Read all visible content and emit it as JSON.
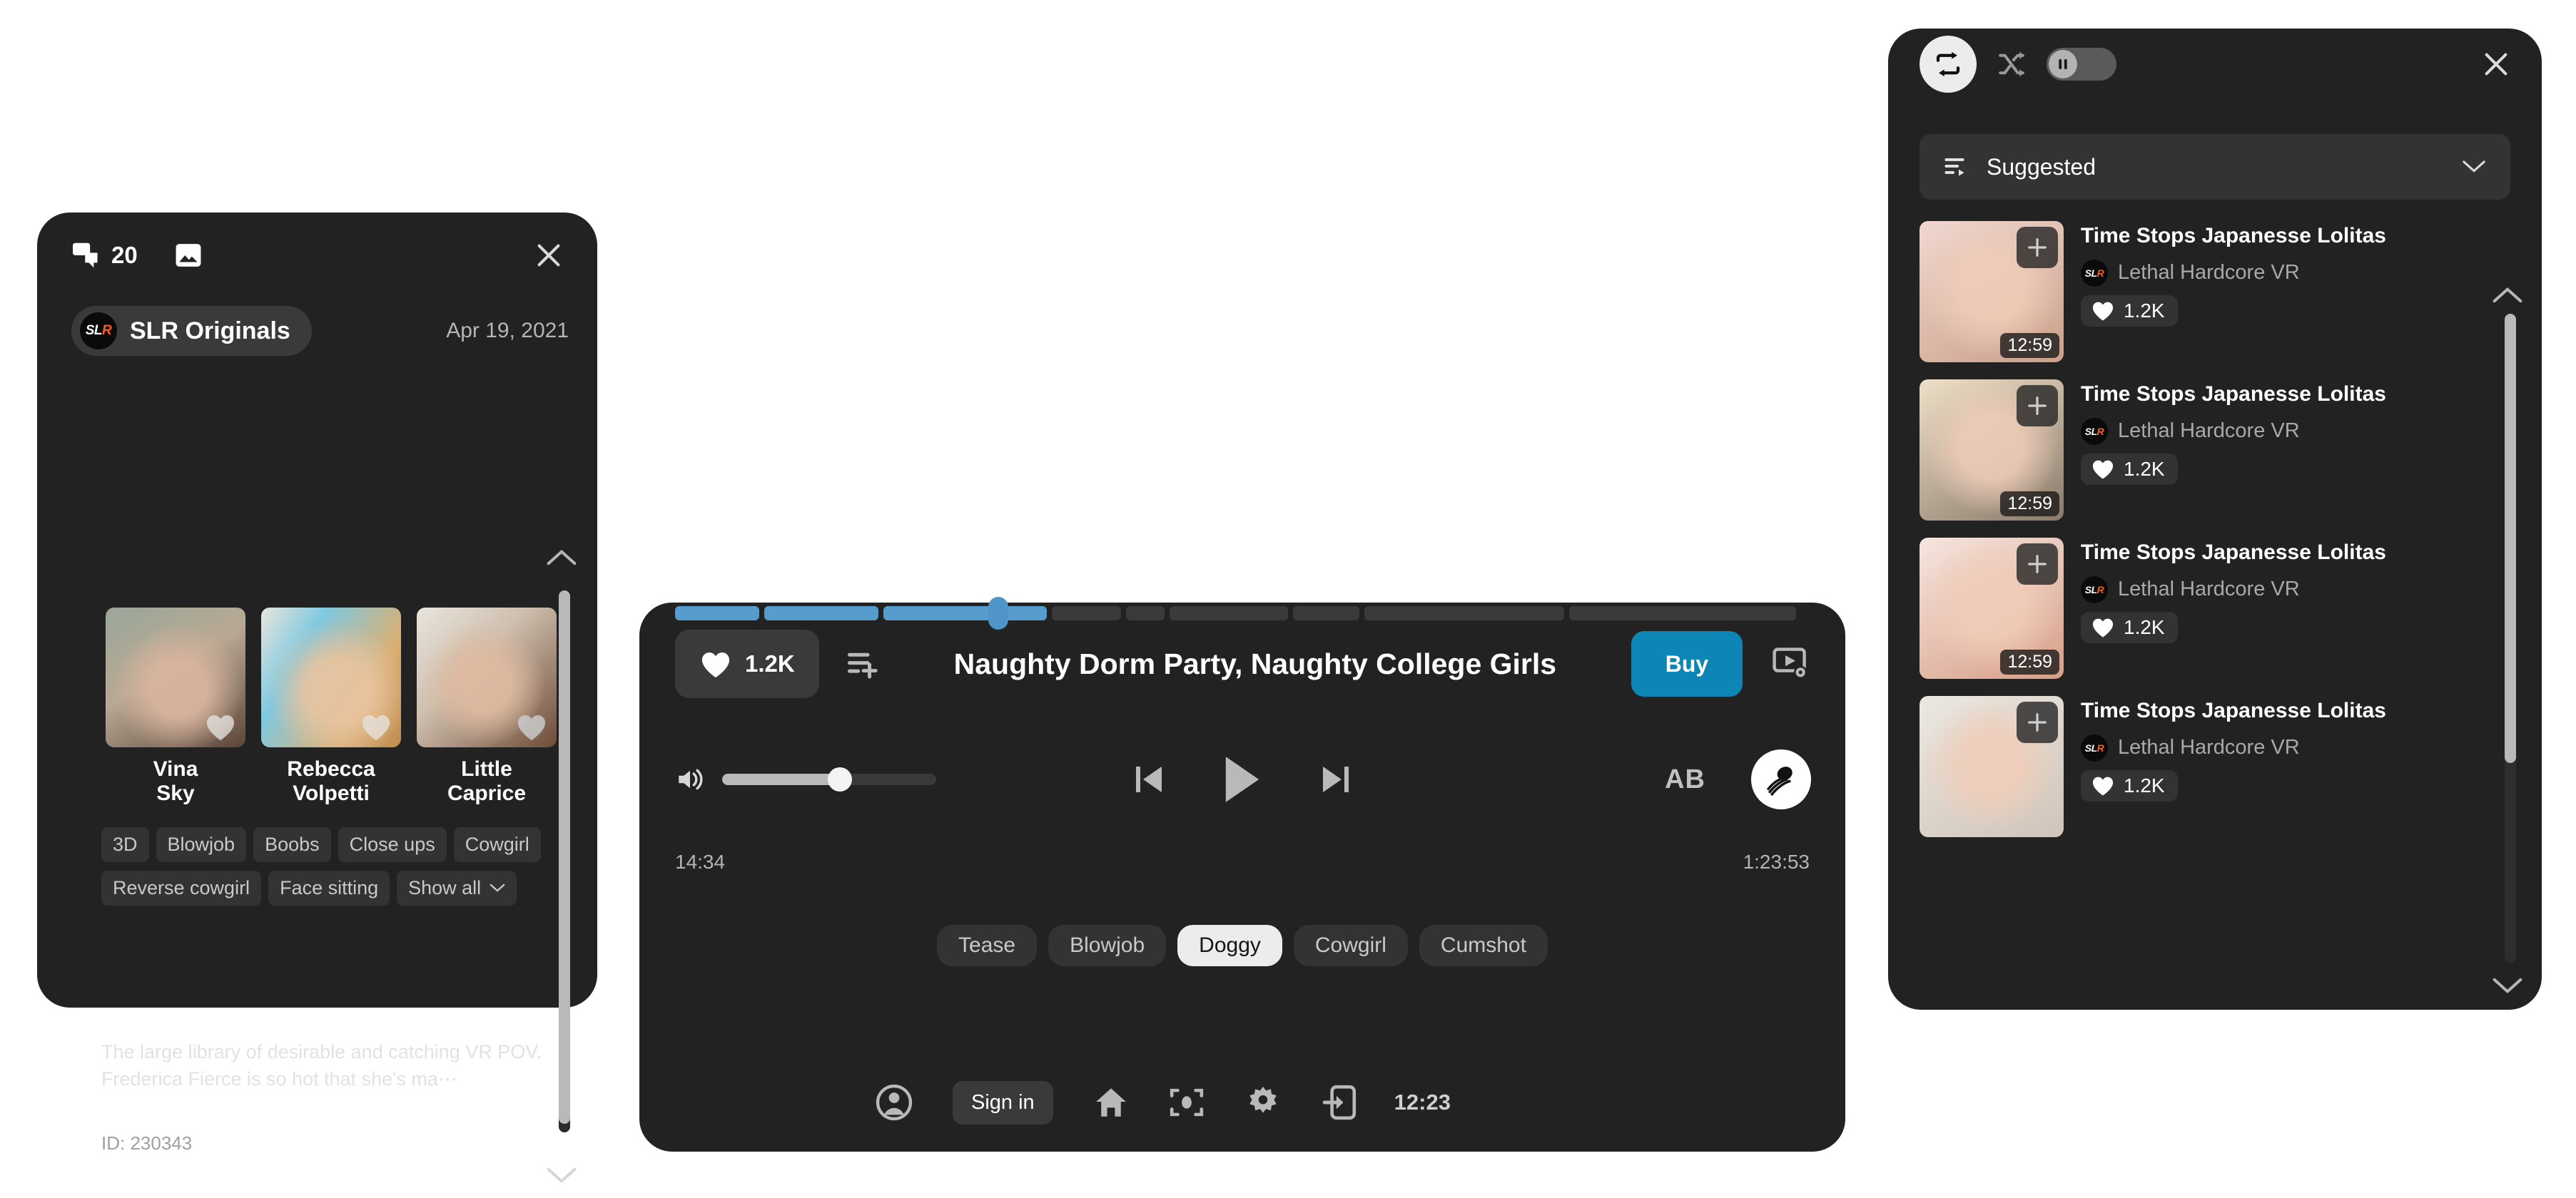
{
  "info_panel": {
    "comment_count": "20",
    "gallery_icon": "image-icon",
    "close_icon": "close-icon",
    "studio_badge": {
      "prefix": "SL",
      "suffix": "R"
    },
    "studio_name": "SLR Originals",
    "date": "Apr 19, 2021",
    "actors": [
      {
        "name": "Vina\nSky",
        "line1": "Vina",
        "line2": "Sky",
        "img_from": "#9aa79a",
        "img_to": "#c8b39c"
      },
      {
        "name": "Rebecca\nVolpetti",
        "line1": "Rebecca",
        "line2": "Volpetti",
        "img_from": "#7fc9e0",
        "img_to": "#d9b074"
      },
      {
        "name": "Little\nCaprice",
        "line1": "Little",
        "line2": "Caprice",
        "img_from": "#d8d3cd",
        "img_to": "#7a5a48"
      }
    ],
    "tags": [
      "3D",
      "Blowjob",
      "Boobs",
      "Close ups",
      "Cowgirl",
      "Reverse cowgirl",
      "Face sitting"
    ],
    "show_all_label": "Show all",
    "description": "The large library of desirable and catching VR POV. Frederica Fierce is so hot that she's ma⋯",
    "video_id": "ID: 230343"
  },
  "player": {
    "like_count": "1.2K",
    "title": "Naughty Dorm Party, Naughty College Girls",
    "buy_label": "Buy",
    "cast_icon": "cast-settings-icon",
    "add_to_playlist_icon": "playlist-add-icon",
    "volume_icon": "volume-icon",
    "volume_percent": 55,
    "prev_icon": "skip-previous-icon",
    "play_icon": "play-icon",
    "next_icon": "skip-next-icon",
    "ab_label": "AB",
    "lens_icon": "lens-icon",
    "current_time": "14:34",
    "total_time": "1:23:53",
    "progress_percent": 28.5,
    "segments": [
      {
        "width": 7.4,
        "done": true
      },
      {
        "width": 10.1,
        "done": true
      },
      {
        "width": 14.4,
        "done": true
      },
      {
        "width": 6.1,
        "done": false
      },
      {
        "width": 3.4,
        "done": false
      },
      {
        "width": 10.4,
        "done": false
      },
      {
        "width": 5.9,
        "done": false
      },
      {
        "width": 17.6,
        "done": false
      },
      {
        "width": 20.0,
        "done": false
      }
    ],
    "scene_chips": [
      {
        "label": "Tease",
        "active": false
      },
      {
        "label": "Blowjob",
        "active": false
      },
      {
        "label": "Doggy",
        "active": true
      },
      {
        "label": "Cowgirl",
        "active": false
      },
      {
        "label": "Cumshot",
        "active": false
      }
    ]
  },
  "playlist_panel": {
    "repeat_icon": "repeat-icon",
    "shuffle_icon": "shuffle-icon",
    "pause_toggle_icon": "pause-icon",
    "close_icon": "close-icon",
    "sort_icon": "playlist-sort-icon",
    "sort_label": "Suggested",
    "sort_chevron": "chevron-down-icon",
    "scroll_up_icon": "chevron-up-icon",
    "scroll_down_icon": "chevron-down-icon",
    "items": [
      {
        "title": "Time Stops Japanesse Lolitas",
        "studio": "Lethal Hardcore VR",
        "likes": "1.2K",
        "duration": "12:59",
        "img_from": "#f0d8d0",
        "img_to": "#caa089"
      },
      {
        "title": "Time Stops Japanesse Lolitas",
        "studio": "Lethal Hardcore VR",
        "likes": "1.2K",
        "duration": "12:59",
        "img_from": "#efe0c9",
        "img_to": "#8a7a6a"
      },
      {
        "title": "Time Stops Japanesse Lolitas",
        "studio": "Lethal Hardcore VR",
        "likes": "1.2K",
        "duration": "12:59",
        "img_from": "#f6e6e0",
        "img_to": "#d79e86"
      },
      {
        "title": "Time Stops Japanesse Lolitas",
        "studio": "Lethal Hardcore VR",
        "likes": "1.2K",
        "duration": "",
        "img_from": "#ece8e2",
        "img_to": "#cfc4b8"
      }
    ]
  },
  "taskbar": {
    "account_icon": "account-icon",
    "signin_label": "Sign in",
    "home_icon": "home-icon",
    "recenter_icon": "recenter-icon",
    "settings_icon": "gear-icon",
    "exit_icon": "exit-icon",
    "clock": "12:23"
  },
  "colors": {
    "panel_bg": "#222222",
    "accent_buy": "#0e86b5",
    "progress_done": "#569ccd",
    "chip_active_bg": "#ececec",
    "slr_orange": "#ff5a1f"
  }
}
